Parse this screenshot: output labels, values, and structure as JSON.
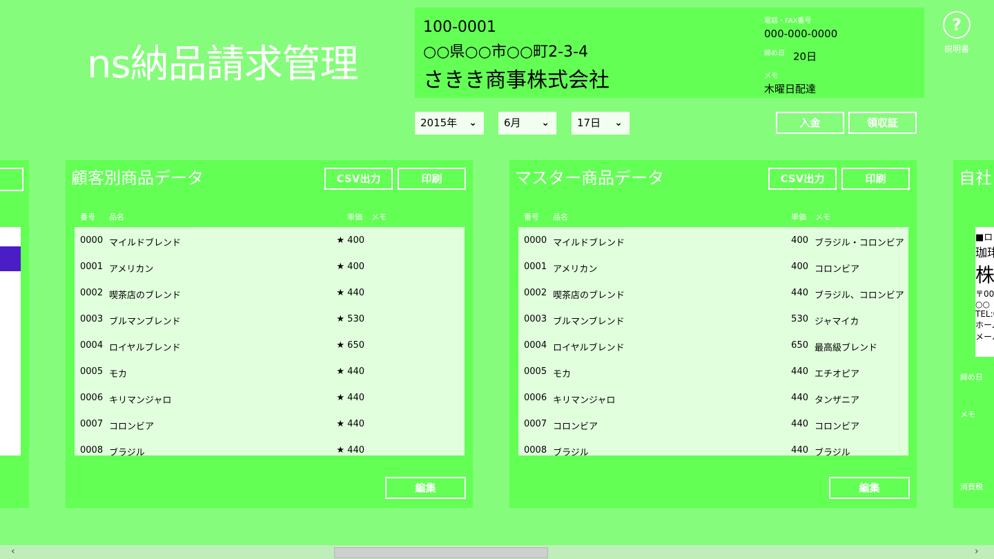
{
  "app_title": "ns納品請求管理",
  "customer": {
    "zip": "100-0001",
    "address": "○○県○○市○○町2-3-4",
    "company": "さきき商事株式会社",
    "phone_label": "電話・FAX番号",
    "phone": "000-000-0000",
    "closing_label": "締め日",
    "closing": "20日",
    "memo_label": "メモ",
    "memo": "木曜日配達"
  },
  "help": {
    "label": "説明書"
  },
  "date": {
    "year": "2015年",
    "month": "6月",
    "day": "17日"
  },
  "actions": {
    "payment": "入金",
    "receipt": "領収証"
  },
  "customer_products": {
    "title": "顧客別商品データ",
    "csv_label": "CSV出力",
    "print_label": "印刷",
    "edit_label": "編集",
    "columns": {
      "num": "番号",
      "name": "品名",
      "price": "単価",
      "memo": "メモ"
    },
    "rows": [
      {
        "num": "0000",
        "name": "マイルドブレンド",
        "price": "★ 400",
        "memo": ""
      },
      {
        "num": "0001",
        "name": "アメリカン",
        "price": "★ 400",
        "memo": ""
      },
      {
        "num": "0002",
        "name": "喫茶店のブレンド",
        "price": "★ 440",
        "memo": ""
      },
      {
        "num": "0003",
        "name": "ブルマンブレンド",
        "price": "★ 530",
        "memo": ""
      },
      {
        "num": "0004",
        "name": "ロイヤルブレンド",
        "price": "★ 650",
        "memo": ""
      },
      {
        "num": "0005",
        "name": "モカ",
        "price": "★ 440",
        "memo": ""
      },
      {
        "num": "0006",
        "name": "キリマンジャロ",
        "price": "★ 440",
        "memo": ""
      },
      {
        "num": "0007",
        "name": "コロンビア",
        "price": "★ 440",
        "memo": ""
      },
      {
        "num": "0008",
        "name": "ブラジル",
        "price": "★ 440",
        "memo": ""
      }
    ]
  },
  "master_products": {
    "title": "マスター商品データ",
    "csv_label": "CSV出力",
    "print_label": "印刷",
    "edit_label": "編集",
    "columns": {
      "num": "番号",
      "name": "品名",
      "price": "単価",
      "memo": "メモ"
    },
    "rows": [
      {
        "num": "0000",
        "name": "マイルドブレンド",
        "price": "400",
        "memo": "ブラジル・コロンビア"
      },
      {
        "num": "0001",
        "name": "アメリカン",
        "price": "400",
        "memo": "コロンビア"
      },
      {
        "num": "0002",
        "name": "喫茶店のブレンド",
        "price": "440",
        "memo": "ブラジル、コロンビア"
      },
      {
        "num": "0003",
        "name": "ブルマンブレンド",
        "price": "530",
        "memo": "ジャマイカ"
      },
      {
        "num": "0004",
        "name": "ロイヤルブレンド",
        "price": "650",
        "memo": "最高級ブレンド"
      },
      {
        "num": "0005",
        "name": "モカ",
        "price": "440",
        "memo": "エチオピア"
      },
      {
        "num": "0006",
        "name": "キリマンジャロ",
        "price": "440",
        "memo": "タンザニア"
      },
      {
        "num": "0007",
        "name": "コロンビア",
        "price": "440",
        "memo": "コロンビア"
      },
      {
        "num": "0008",
        "name": "ブラジル",
        "price": "440",
        "memo": "ブラジル"
      }
    ]
  },
  "right_panel": {
    "title": "自社",
    "paper_lines": [
      "■ロ",
      "珈琲",
      "株",
      "〒00",
      "○○",
      "TEL:0",
      "ホーム",
      "メール"
    ],
    "closing_label": "締め日",
    "memo_label": "メモ",
    "tax_label": "消費税"
  },
  "scroll": {
    "left_arrow": "‹",
    "right_arrow": "›"
  }
}
